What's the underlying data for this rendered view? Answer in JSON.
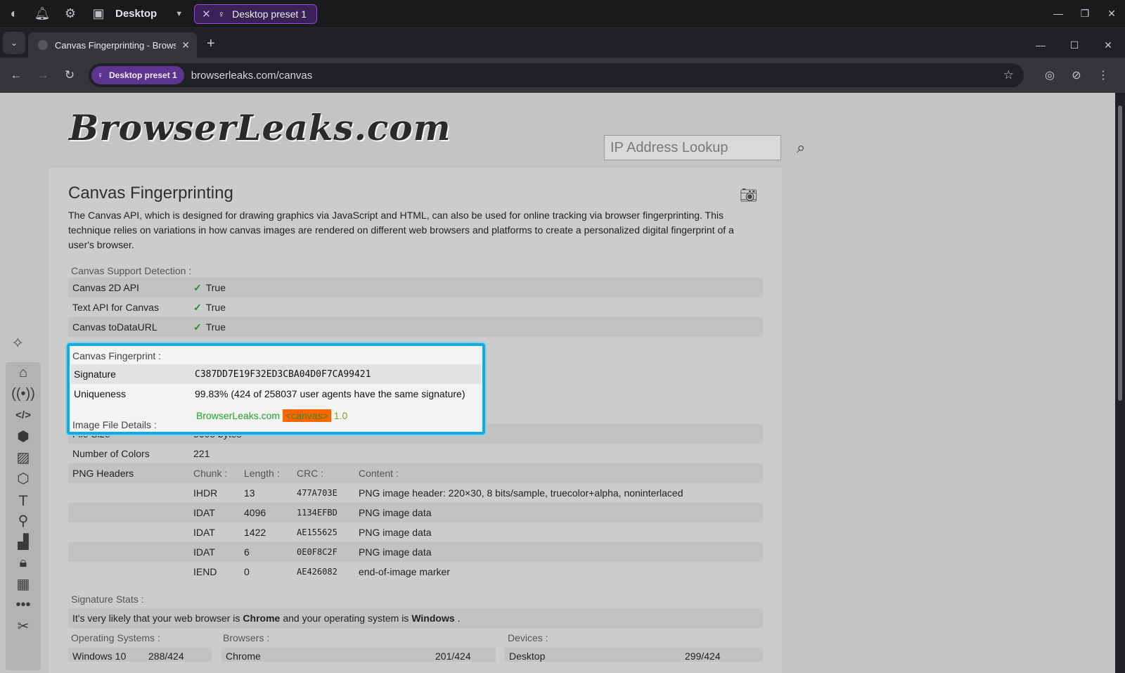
{
  "appbar": {
    "title": "Desktop",
    "preset_tab": "Desktop preset 1"
  },
  "tabs": [
    {
      "label": "Canvas Fingerprinting - Browse"
    }
  ],
  "toolbar": {
    "profile_chip": "Desktop preset 1",
    "url": "browserleaks.com/canvas"
  },
  "site": {
    "logo": "BrowserLeaks.com",
    "search_placeholder": "IP Address Lookup"
  },
  "main": {
    "title": "Canvas Fingerprinting",
    "description": "The Canvas API, which is designed for drawing graphics via JavaScript and HTML, can also be used for online tracking via browser fingerprinting. This technique relies on variations in how canvas images are rendered on different web browsers and platforms to create a personalized digital fingerprint of a user's browser.",
    "support_header": "Canvas Support Detection :",
    "support_rows": [
      {
        "key": "Canvas 2D API",
        "value": "True"
      },
      {
        "key": "Text API for Canvas",
        "value": "True"
      },
      {
        "key": "Canvas toDataURL",
        "value": "True"
      }
    ],
    "fingerprint_header": "Canvas Fingerprint :",
    "signature_label": "Signature",
    "signature_value": "C387DD7E19F32ED3CBA04D0F7CA99421",
    "uniqueness_label": "Uniqueness",
    "uniqueness_value": "99.83% (424 of 258037 user agents have the same signature)",
    "image_details_header": "Image File Details :",
    "canvas_image_text": {
      "a": "BrowserLeaks.com",
      "b": "<canvas>",
      "c": "1.0"
    },
    "file_rows": [
      {
        "key": "File Size",
        "value": "5605 bytes"
      },
      {
        "key": "Number of Colors",
        "value": "221"
      }
    ],
    "png_label": "PNG Headers",
    "png_columns": [
      "Chunk :",
      "Length :",
      "CRC :",
      "Content :"
    ],
    "png_rows": [
      {
        "chunk": "IHDR",
        "length": "13",
        "crc": "477A703E",
        "content": "PNG image header: 220×30, 8 bits/sample, truecolor+alpha, noninterlaced"
      },
      {
        "chunk": "IDAT",
        "length": "4096",
        "crc": "1134EFBD",
        "content": "PNG image data"
      },
      {
        "chunk": "IDAT",
        "length": "1422",
        "crc": "AE155625",
        "content": "PNG image data"
      },
      {
        "chunk": "IDAT",
        "length": "6",
        "crc": "0E0F8C2F",
        "content": "PNG image data"
      },
      {
        "chunk": "IEND",
        "length": "0",
        "crc": "AE426082",
        "content": "end-of-image marker"
      }
    ],
    "stats_header": "Signature Stats :",
    "stats_line": {
      "pre": "It's very likely that your web browser is",
      "browser": "Chrome",
      "mid": "and your operating system is",
      "os": "Windows",
      "end": "."
    },
    "stats_columns": [
      "Operating Systems :",
      "Browsers :",
      "Devices :"
    ],
    "stats_values": [
      {
        "name": "Windows 10",
        "count": "288/424"
      },
      {
        "name": "Chrome",
        "count": "201/424"
      },
      {
        "name": "Desktop",
        "count": "299/424"
      }
    ]
  },
  "colors": {
    "accent_highlight": "#19a7dc",
    "preset_purple": "#8a4fd8",
    "check_green": "#1f8b2a"
  }
}
